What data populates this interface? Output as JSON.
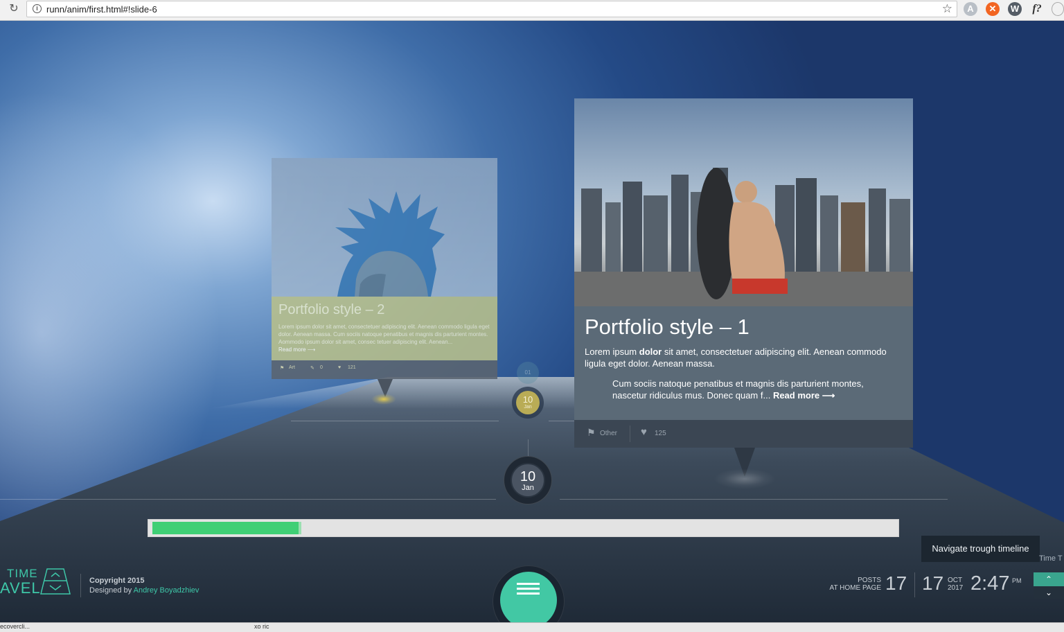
{
  "browser": {
    "url": "runn/anim/first.html#!slide-6",
    "extensions": [
      "angular-icon",
      "orange-extension-icon",
      "wordpress-icon",
      "f-question-icon",
      "cutoff-extension-icon"
    ]
  },
  "colors": {
    "accent": "#3ec7a8",
    "progress": "#3fcf75",
    "card_faded_panel": "#b8c08c",
    "card_panel": "#5b6a77"
  },
  "card_secondary": {
    "title": "Portfolio style – 2",
    "text": "Lorem ipsum dolor sit amet, consectetuer adipiscing elit. Aenean commodo ligula eget dolor. Aenean massa. Cum sociis natoque penatibus et magnis dis parturient montes. Aommodo ipsum dolor sit amet, consec tetuer adipiscing elit. Aenean...",
    "read_more": "Read more ⟶",
    "category": "Art",
    "comments": "0",
    "likes": "121"
  },
  "card_main": {
    "title": "Portfolio style – 1",
    "lead_before": "Lorem ipsum ",
    "lead_bold": "dolor",
    "lead_after": " sit amet, consectetuer adipiscing elit. Aenean commodo ligula eget dolor. Aenean massa.",
    "quote": "Cum sociis natoque penatibus et magnis dis parturient montes, nascetur ridiculus mus. Donec quam f... ",
    "read_more": "Read more ⟶",
    "category": "Other",
    "likes": "125"
  },
  "dates": {
    "current": {
      "day": "10",
      "month": "Jan"
    },
    "previous": {
      "day": "10",
      "month": "Jan"
    },
    "faint": "01"
  },
  "progress": {
    "percent": 20
  },
  "tooltip": "Navigate trough timeline",
  "tooltip_overflow": "Time T",
  "footer": {
    "logo_line1": "TIME",
    "logo_line2": "AVEL",
    "copyright": "Copyright 2015",
    "designed_by": "Designed by ",
    "author": "Andrey Boyadzhiev",
    "posts_label_1": "POSTS",
    "posts_label_2": "AT HOME PAGE",
    "posts_count": "17",
    "date_day": "17",
    "date_month": "OCT",
    "date_year": "2017",
    "time": "2:47",
    "ampm": "PM"
  },
  "status_strip": {
    "left": "ecovercli...",
    "mid": "xo ric"
  }
}
